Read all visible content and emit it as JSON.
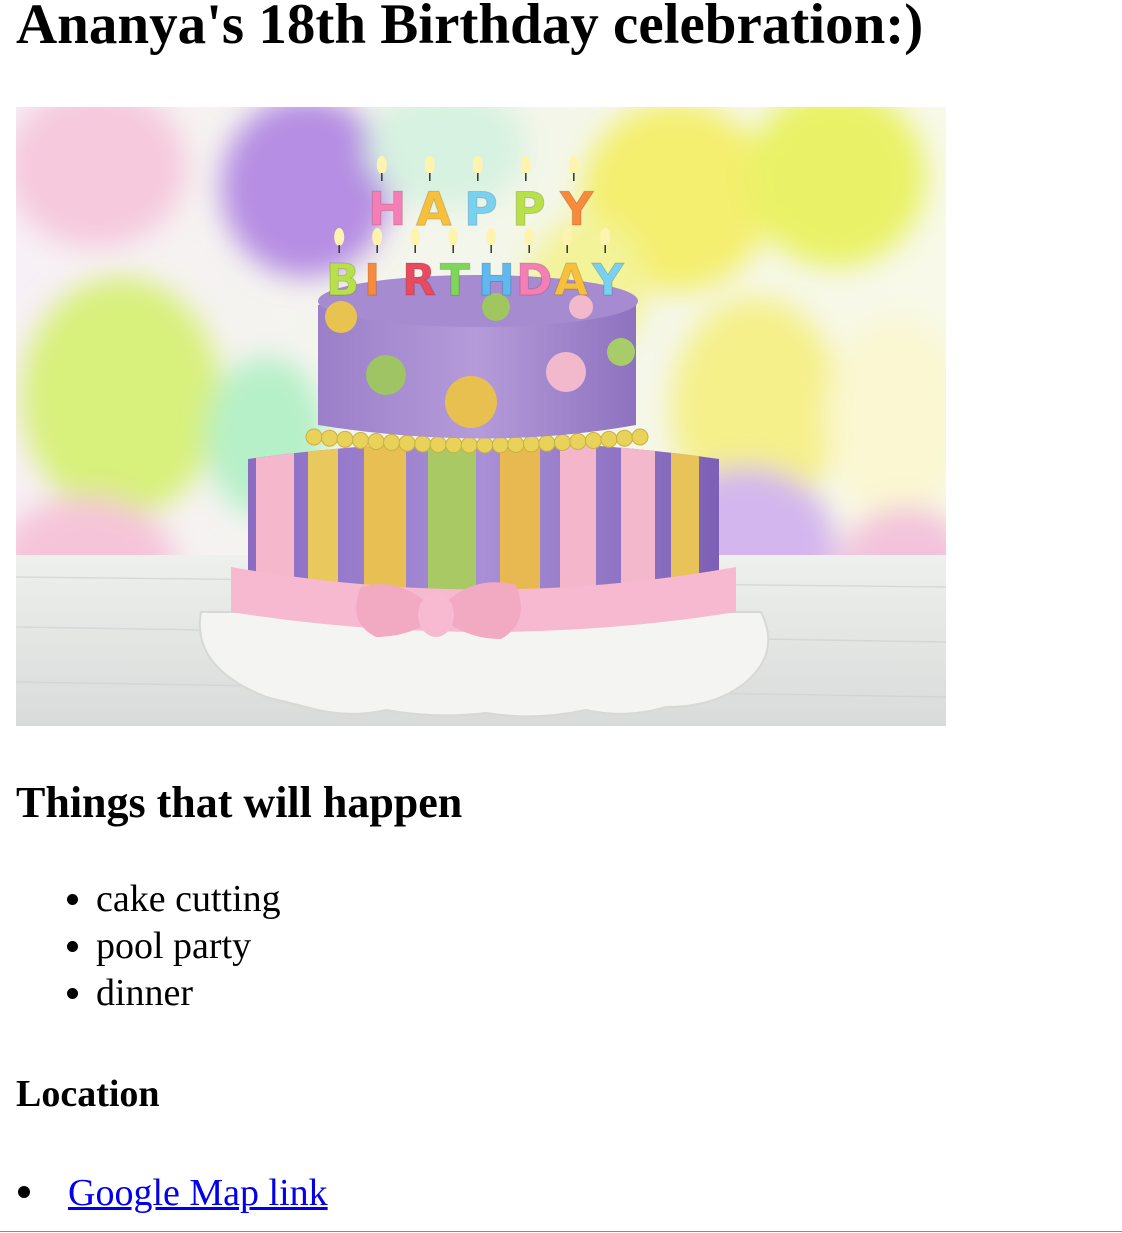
{
  "page": {
    "title": "Ananya's 18th Birthday celebration:)",
    "hero_image": {
      "alt": "cake",
      "candle_letters_top": [
        "H",
        "A",
        "P",
        "P",
        "Y"
      ],
      "candle_letters_bottom": [
        "B",
        "I",
        "R",
        "T",
        "H",
        "D",
        "A",
        "Y"
      ]
    },
    "events": {
      "heading": "Things that will happen",
      "items": [
        "cake cutting",
        "pool party",
        "dinner"
      ]
    },
    "location": {
      "heading": "Location",
      "link_text": "Google Map link"
    }
  },
  "colors": {
    "link": "#0000ee",
    "text": "#000000",
    "background": "#ffffff"
  }
}
